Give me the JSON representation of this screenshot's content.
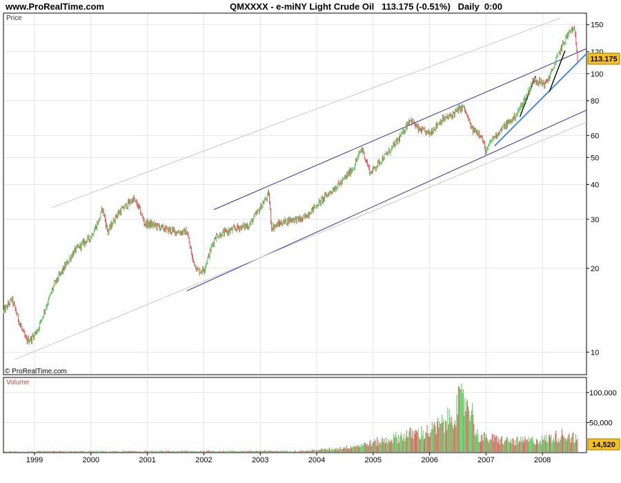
{
  "header": {
    "site": "www.ProRealTime.com",
    "title": "QMXXXX - e-miNY Light Crude Oil   113.175 (-0.51%)   Daily  0:00"
  },
  "colors": {
    "up": "#55c455",
    "down": "#dd5555",
    "channel": "#2b2bb8",
    "trend": "#3f8ee0",
    "ghost": "#c8c8c8",
    "grid": "#e4e4e4",
    "badge": "#f6c21a"
  },
  "chart_data": [
    {
      "type": "candlestick",
      "panel": "price",
      "label": "Price",
      "scale": "log",
      "ylim": [
        8.3,
        165
      ],
      "y_ticks": [
        10,
        20,
        30,
        40,
        50,
        60,
        80,
        100,
        120,
        150
      ],
      "last_price": "113.175",
      "watermark": "© ProRealTime.com",
      "x_labels": [
        "1999",
        "2000",
        "2001",
        "2002",
        "2003",
        "2004",
        "2005",
        "2006",
        "2007",
        "2008"
      ],
      "x_range": [
        1998.45,
        2008.78
      ],
      "grid": true,
      "price_path": [
        [
          1998.45,
          14.0
        ],
        [
          1998.6,
          15.5
        ],
        [
          1998.72,
          13.0
        ],
        [
          1998.85,
          11.0
        ],
        [
          1998.95,
          11.2
        ],
        [
          1999.05,
          12.0
        ],
        [
          1999.2,
          14.5
        ],
        [
          1999.35,
          17.5
        ],
        [
          1999.55,
          20.5
        ],
        [
          1999.7,
          23.0
        ],
        [
          1999.85,
          24.5
        ],
        [
          2000.0,
          26.0
        ],
        [
          2000.15,
          30.0
        ],
        [
          2000.2,
          33.0
        ],
        [
          2000.3,
          27.0
        ],
        [
          2000.45,
          31.0
        ],
        [
          2000.65,
          34.0
        ],
        [
          2000.75,
          35.5
        ],
        [
          2000.85,
          33.0
        ],
        [
          2000.95,
          29.0
        ],
        [
          2001.15,
          28.5
        ],
        [
          2001.35,
          27.5
        ],
        [
          2001.55,
          27.0
        ],
        [
          2001.7,
          27.0
        ],
        [
          2001.8,
          21.5
        ],
        [
          2001.9,
          19.5
        ],
        [
          2002.0,
          19.8
        ],
        [
          2002.2,
          26.0
        ],
        [
          2002.4,
          27.0
        ],
        [
          2002.6,
          28.0
        ],
        [
          2002.8,
          28.5
        ],
        [
          2003.0,
          33.0
        ],
        [
          2003.15,
          37.0
        ],
        [
          2003.2,
          28.0
        ],
        [
          2003.35,
          29.0
        ],
        [
          2003.55,
          30.0
        ],
        [
          2003.75,
          30.0
        ],
        [
          2003.95,
          33.0
        ],
        [
          2004.2,
          37.0
        ],
        [
          2004.45,
          41.0
        ],
        [
          2004.65,
          46.0
        ],
        [
          2004.8,
          54.0
        ],
        [
          2004.95,
          44.0
        ],
        [
          2005.1,
          48.0
        ],
        [
          2005.3,
          53.0
        ],
        [
          2005.5,
          60.0
        ],
        [
          2005.65,
          69.0
        ],
        [
          2005.8,
          63.0
        ],
        [
          2006.0,
          61.0
        ],
        [
          2006.2,
          68.0
        ],
        [
          2006.35,
          70.0
        ],
        [
          2006.5,
          74.0
        ],
        [
          2006.6,
          76.0
        ],
        [
          2006.75,
          63.0
        ],
        [
          2006.9,
          61.0
        ],
        [
          2007.0,
          52.0
        ],
        [
          2007.1,
          58.0
        ],
        [
          2007.3,
          64.0
        ],
        [
          2007.45,
          68.0
        ],
        [
          2007.55,
          72.0
        ],
        [
          2007.7,
          82.0
        ],
        [
          2007.85,
          96.0
        ],
        [
          2007.95,
          93.0
        ],
        [
          2008.05,
          92.0
        ],
        [
          2008.15,
          100.0
        ],
        [
          2008.3,
          120.0
        ],
        [
          2008.42,
          135.0
        ],
        [
          2008.52,
          145.0
        ],
        [
          2008.58,
          140.0
        ],
        [
          2008.62,
          113.175
        ]
      ],
      "lines": [
        {
          "kind": "channel-upper",
          "from": [
            2002.18,
            32.5
          ],
          "to": [
            2008.78,
            123
          ]
        },
        {
          "kind": "channel-lower",
          "from": [
            2001.7,
            16.6
          ],
          "to": [
            2008.78,
            74
          ]
        },
        {
          "kind": "outer-upper",
          "from": [
            1999.3,
            33.0
          ],
          "to": [
            2008.3,
            158
          ]
        },
        {
          "kind": "outer-lower",
          "from": [
            1998.65,
            9.4
          ],
          "to": [
            2008.78,
            67
          ]
        },
        {
          "kind": "trend-blue",
          "from": [
            2007.15,
            55
          ],
          "to": [
            2008.78,
            118
          ]
        },
        {
          "kind": "black-1",
          "from": [
            2007.6,
            70
          ],
          "to": [
            2007.88,
            98
          ]
        },
        {
          "kind": "black-2",
          "from": [
            2008.12,
            86
          ],
          "to": [
            2008.4,
            121
          ]
        }
      ]
    },
    {
      "type": "bar",
      "panel": "volume",
      "label": "Volume",
      "ylim": [
        0,
        125000
      ],
      "y_ticks": [
        50000,
        100000
      ],
      "y_tick_labels": [
        "50,000",
        "100,000"
      ],
      "last_value": "14,520",
      "volume_path": [
        [
          1998.45,
          2000
        ],
        [
          2003.8,
          3000
        ],
        [
          2004.4,
          8000
        ],
        [
          2004.8,
          14000
        ],
        [
          2005.2,
          22000
        ],
        [
          2005.6,
          32000
        ],
        [
          2006.0,
          38000
        ],
        [
          2006.3,
          55000
        ],
        [
          2006.55,
          90000
        ],
        [
          2006.7,
          92000
        ],
        [
          2006.85,
          30000
        ],
        [
          2007.0,
          26000
        ],
        [
          2007.5,
          20000
        ],
        [
          2008.0,
          23000
        ],
        [
          2008.4,
          33000
        ],
        [
          2008.62,
          24000
        ]
      ]
    }
  ]
}
